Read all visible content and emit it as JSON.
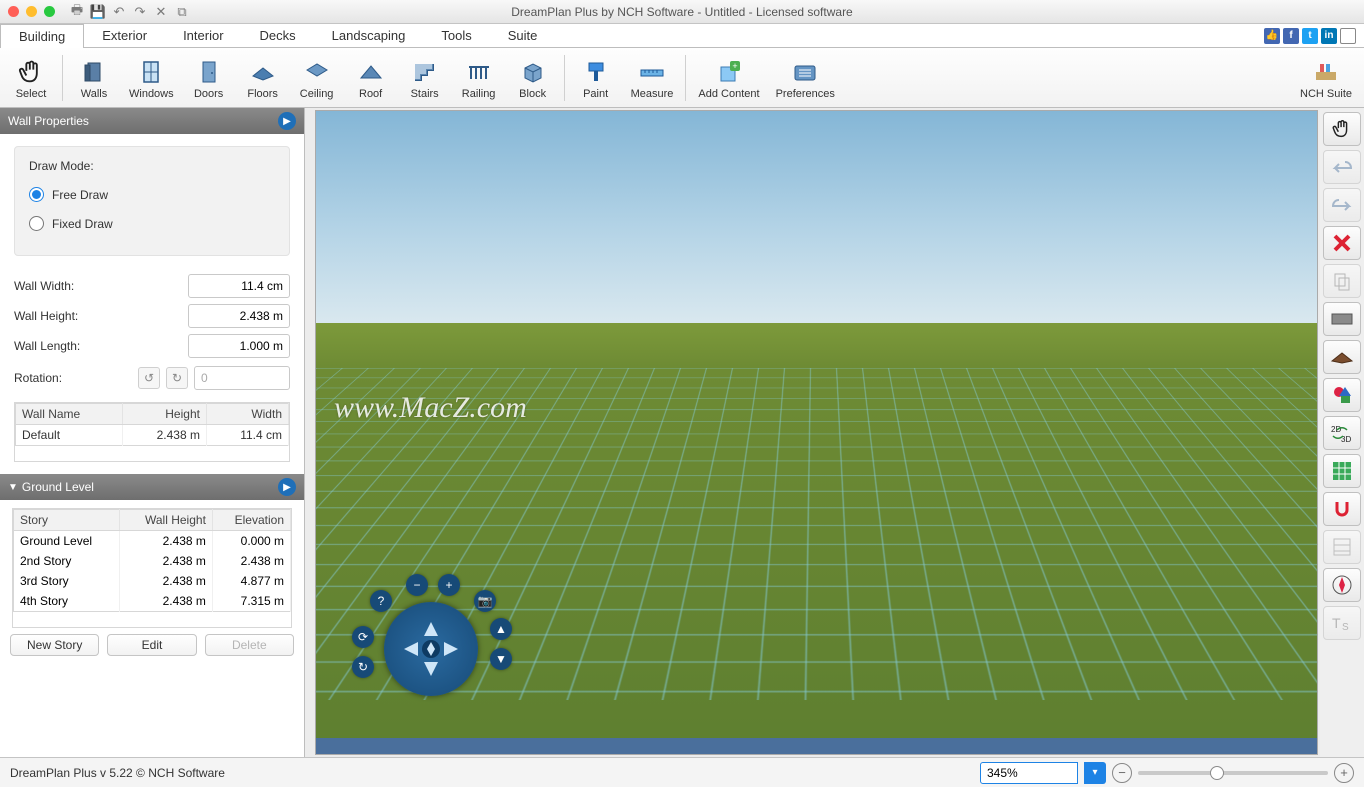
{
  "window": {
    "title": "DreamPlan Plus by NCH Software - Untitled - Licensed software"
  },
  "menubar": {
    "tabs": [
      "Building",
      "Exterior",
      "Interior",
      "Decks",
      "Landscaping",
      "Tools",
      "Suite"
    ],
    "active": 0
  },
  "ribbon": {
    "items": [
      "Select",
      "Walls",
      "Windows",
      "Doors",
      "Floors",
      "Ceiling",
      "Roof",
      "Stairs",
      "Railing",
      "Block",
      "Paint",
      "Measure",
      "Add Content",
      "Preferences"
    ],
    "suite": "NCH Suite"
  },
  "panel1": {
    "title": "Wall Properties",
    "drawModeLabel": "Draw Mode:",
    "freeDraw": "Free Draw",
    "fixedDraw": "Fixed Draw",
    "wallWidthLabel": "Wall Width:",
    "wallWidthValue": "11.4 cm",
    "wallHeightLabel": "Wall Height:",
    "wallHeightValue": "2.438 m",
    "wallLengthLabel": "Wall Length:",
    "wallLengthValue": "1.000 m",
    "rotationLabel": "Rotation:",
    "rotationValue": "0",
    "tableHeaders": [
      "Wall Name",
      "Height",
      "Width"
    ],
    "tableRow": [
      "Default",
      "2.438 m",
      "11.4 cm"
    ]
  },
  "panel2": {
    "title": "Ground Level",
    "headers": [
      "Story",
      "Wall Height",
      "Elevation"
    ],
    "rows": [
      [
        "Ground Level",
        "2.438 m",
        "0.000 m"
      ],
      [
        "2nd Story",
        "2.438 m",
        "2.438 m"
      ],
      [
        "3rd Story",
        "2.438 m",
        "4.877 m"
      ],
      [
        "4th Story",
        "2.438 m",
        "7.315 m"
      ]
    ],
    "buttons": {
      "new": "New Story",
      "edit": "Edit",
      "delete": "Delete"
    }
  },
  "viewport": {
    "watermark": "www.MacZ.com"
  },
  "status": {
    "text": "DreamPlan Plus v 5.22 © NCH Software",
    "zoom": "345%"
  }
}
